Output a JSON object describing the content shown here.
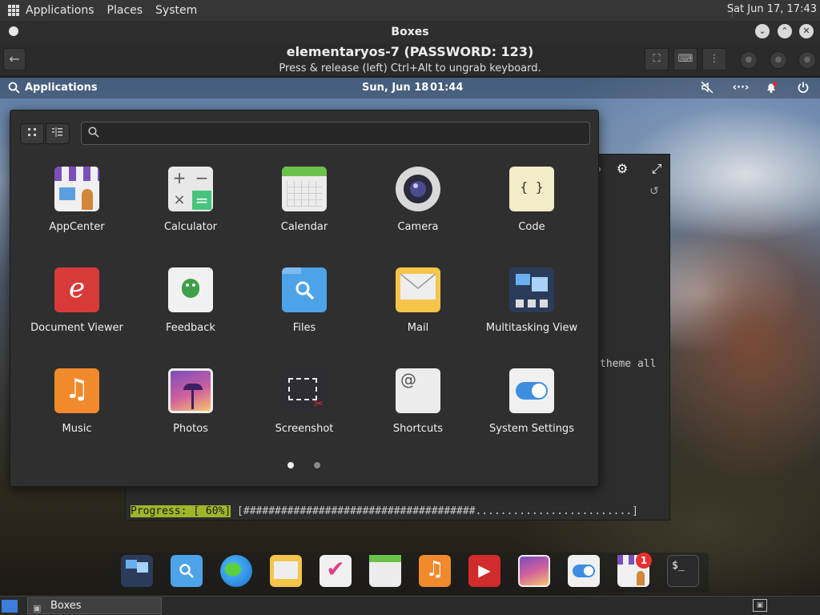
{
  "host_panel": {
    "menus": [
      "Applications",
      "Places",
      "System"
    ],
    "clock": "Sat Jun 17, 17:43"
  },
  "window": {
    "title": "Boxes",
    "vm_name": "elementaryos-7 (PASSWORD: 123)",
    "hint": "Press & release (left) Ctrl+Alt to ungrab keyboard."
  },
  "guest_panel": {
    "applications_label": "Applications",
    "date": "Sun, Jun 18",
    "time": "01:44"
  },
  "terminal": {
    "line1": "theme all",
    "progress_label": "Progress: [ 60%]",
    "progress_bar": " [#####################################.........................]",
    "progress": 0.6
  },
  "launcher": {
    "search_placeholder": "",
    "search_value": "",
    "apps": [
      {
        "label": "AppCenter",
        "icon": "appcenter-icon"
      },
      {
        "label": "Calculator",
        "icon": "calculator-icon"
      },
      {
        "label": "Calendar",
        "icon": "calendar-icon"
      },
      {
        "label": "Camera",
        "icon": "camera-icon"
      },
      {
        "label": "Code",
        "icon": "code-icon"
      },
      {
        "label": "Document Viewer",
        "icon": "document-viewer-icon"
      },
      {
        "label": "Feedback",
        "icon": "feedback-icon"
      },
      {
        "label": "Files",
        "icon": "files-icon"
      },
      {
        "label": "Mail",
        "icon": "mail-icon"
      },
      {
        "label": "Multitasking View",
        "icon": "multitasking-view-icon"
      },
      {
        "label": "Music",
        "icon": "music-icon"
      },
      {
        "label": "Photos",
        "icon": "photos-icon"
      },
      {
        "label": "Screenshot",
        "icon": "screenshot-icon"
      },
      {
        "label": "Shortcuts",
        "icon": "shortcuts-icon"
      },
      {
        "label": "System Settings",
        "icon": "system-settings-icon"
      }
    ],
    "pages": 2,
    "current_page": 1
  },
  "dock": {
    "items": [
      "multitasking-view",
      "files",
      "web-browser",
      "mail",
      "tasks",
      "calendar",
      "music",
      "videos",
      "photos",
      "system-settings",
      "appcenter",
      "terminal"
    ],
    "appcenter_badge": "1"
  },
  "taskbar": {
    "task_label": "Boxes"
  },
  "colors": {
    "accent_progress": "#a0b52a",
    "launcher_bg": "#2f2f2f"
  }
}
